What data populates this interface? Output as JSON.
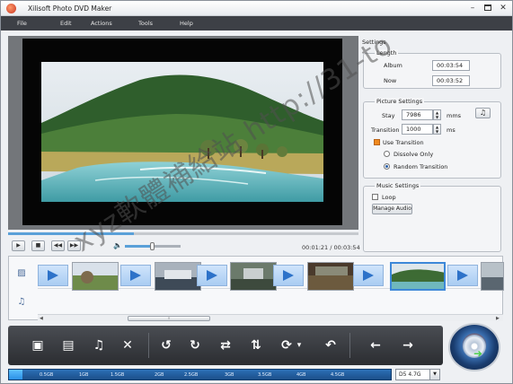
{
  "window": {
    "title": "Xilisoft Photo DVD Maker",
    "minimize_glyph": "–",
    "close_glyph": "✕"
  },
  "menu": [
    "File",
    "Edit",
    "Actions",
    "Tools",
    "Help"
  ],
  "player": {
    "time": "00:01:21 / 00:03:54",
    "progress": 0.36,
    "volume": 0.5,
    "play_glyph": "▶",
    "stop_glyph": "■",
    "prev_glyph": "◀◀",
    "next_glyph": "▶▶",
    "volume_glyph": "🔈"
  },
  "settings": {
    "title": "Settings",
    "length": {
      "legend": "Length",
      "album_label": "Album",
      "album_value": "00:03:54",
      "now_label": "Now",
      "now_value": "00:03:52"
    },
    "picture": {
      "legend": "Picture Settings",
      "stay_label": "Stay",
      "stay_value": "7986",
      "stay_unit": "mms",
      "transition_label": "Transition",
      "transition_value": "1000",
      "transition_unit": "ms",
      "use_transition_label": "Use Transition",
      "use_transition_checked": true,
      "dissolve_label": "Dissolve Only",
      "random_label": "Random Transition",
      "selected_option": "random",
      "music_glyph": "♫"
    },
    "music": {
      "legend": "Music Settings",
      "loop_label": "Loop",
      "loop_checked": false,
      "manage_audio_label": "Manage Audio"
    }
  },
  "storyboard": {
    "photo_lane_icon": "▨",
    "music_lane_icon": "♫",
    "scroll_left": "◀",
    "scroll_right": "▶",
    "scroll_grip": "⁞",
    "selected_index": 4
  },
  "toolbar": {
    "add_photo": "▣",
    "add_folder": "▤",
    "add_music": "♫",
    "remove": "✕",
    "rotate_left": "↺",
    "rotate_right": "↻",
    "flip_horizontal": "⇄",
    "flip_vertical": "⇅",
    "transition": "⟳",
    "dropdown": "▾",
    "undo": "↶",
    "move_left": "←",
    "move_right": "→"
  },
  "capacity": {
    "used_fraction": 0.035,
    "ticks": [
      "0.5GB",
      "1GB",
      "1.5GB",
      "2GB",
      "2.5GB",
      "3GB",
      "3.5GB",
      "4GB",
      "4.5GB"
    ],
    "disc_type": "D5 4.7G",
    "caret": "▼"
  },
  "watermark": "xyz軟體補給站 http://31-to"
}
